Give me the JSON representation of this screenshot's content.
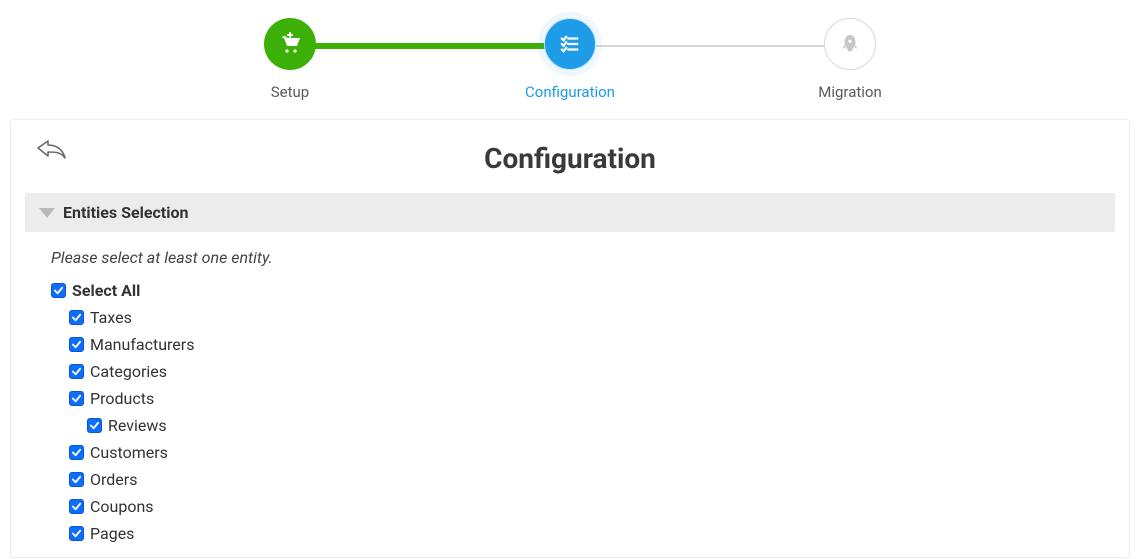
{
  "stepper": {
    "steps": [
      {
        "label": "Setup",
        "state": "done",
        "icon": "cart-plus-icon"
      },
      {
        "label": "Configuration",
        "state": "current",
        "icon": "list-check-icon"
      },
      {
        "label": "Migration",
        "state": "upcoming",
        "icon": "rocket-icon"
      }
    ]
  },
  "page": {
    "title": "Configuration"
  },
  "section": {
    "title": "Entities Selection",
    "instructions": "Please select at least one entity."
  },
  "entities": {
    "select_all_label": "Select All",
    "select_all_checked": true,
    "items": [
      {
        "label": "Taxes",
        "checked": true,
        "level": 1
      },
      {
        "label": "Manufacturers",
        "checked": true,
        "level": 1
      },
      {
        "label": "Categories",
        "checked": true,
        "level": 1
      },
      {
        "label": "Products",
        "checked": true,
        "level": 1
      },
      {
        "label": "Reviews",
        "checked": true,
        "level": 2
      },
      {
        "label": "Customers",
        "checked": true,
        "level": 1
      },
      {
        "label": "Orders",
        "checked": true,
        "level": 1
      },
      {
        "label": "Coupons",
        "checked": true,
        "level": 1
      },
      {
        "label": "Pages",
        "checked": true,
        "level": 1
      }
    ]
  },
  "colors": {
    "green": "#3db008",
    "blue": "#1e9ce8",
    "checkbox": "#0d6efd"
  }
}
